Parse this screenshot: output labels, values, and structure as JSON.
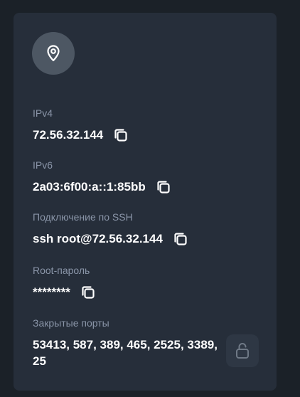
{
  "icons": {
    "location": "map-pin-icon",
    "copy": "copy-icon",
    "lock": "unlocked-lock-icon"
  },
  "fields": {
    "ipv4": {
      "label": "IPv4",
      "value": "72.56.32.144"
    },
    "ipv6": {
      "label": "IPv6",
      "value": "2a03:6f00:a::1:85bb"
    },
    "ssh": {
      "label": "Подключение по SSH",
      "value": "ssh root@72.56.32.144"
    },
    "root_password": {
      "label": "Root-пароль",
      "value": "********"
    },
    "closed_ports": {
      "label": "Закрытые порты",
      "value": "53413, 587, 389, 465, 2525, 3389, 25"
    }
  },
  "colors": {
    "page_bg": "#1b2128",
    "card_bg": "#262e3a",
    "label": "#8a95a8",
    "value": "#ffffff"
  }
}
